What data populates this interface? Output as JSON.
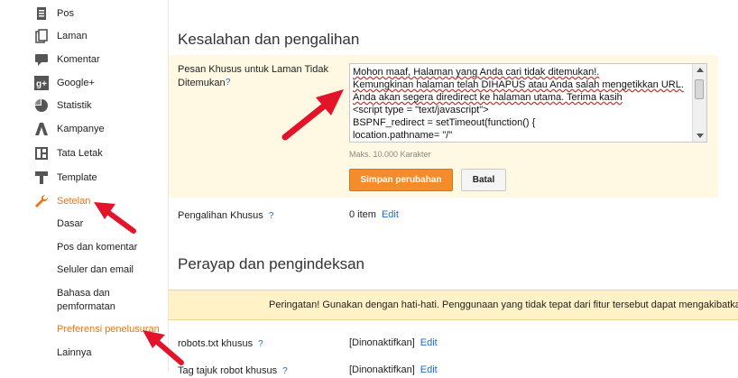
{
  "sidebar": {
    "items": [
      {
        "label": "Pos",
        "icon": "posts-icon"
      },
      {
        "label": "Laman",
        "icon": "pages-icon"
      },
      {
        "label": "Komentar",
        "icon": "comments-icon"
      },
      {
        "label": "Google+",
        "icon": "google-plus-icon"
      },
      {
        "label": "Statistik",
        "icon": "stats-icon"
      },
      {
        "label": "Kampanye",
        "icon": "campaign-icon"
      },
      {
        "label": "Tata Letak",
        "icon": "layout-icon"
      },
      {
        "label": "Template",
        "icon": "template-icon"
      },
      {
        "label": "Setelan",
        "icon": "settings-wrench-icon"
      }
    ],
    "sub_items": [
      "Dasar",
      "Pos dan komentar",
      "Seluler dan email",
      "Bahasa dan\npemformatan",
      "Preferensi penelusuran",
      "Lainnya"
    ]
  },
  "errors_section": {
    "title": "Kesalahan dan pengalihan",
    "custom_404_label": "Pesan Khusus untuk Laman Tidak\nDitemukan",
    "help": "?",
    "message_lines": [
      "Mohon maaf, Halaman yang Anda cari tidak ditemukan!.",
      "Kemungkinan halaman telah DIHAPUS atau Anda salah mengetikkan URL.",
      "Anda akan segera diredirect ke halaman utama. Terima kasih",
      "<script type = \"text/javascript\">",
      "BSPNF_redirect = setTimeout(function() {",
      "location.pathname= \"/\""
    ],
    "max_chars": "Maks. 10.000 Karakter",
    "save_label": "Simpan perubahan",
    "cancel_label": "Batal",
    "redirect_label": "Pengalihan Khusus",
    "redirect_value": "0 item",
    "edit_label": "Edit"
  },
  "crawl_section": {
    "title": "Perayap dan pengindeksan",
    "warning": "Peringatan! Gunakan dengan hati-hati. Penggunaan yang tidak tepat dari fitur tersebut dapat mengakibatkan b",
    "robots_label": "robots.txt khusus",
    "robots_value": "[Dinonaktifkan]",
    "robot_tags_label": "Tag tajuk robot khusus",
    "robot_tags_value": "[Dinonaktifkan]",
    "edit_label": "Edit"
  },
  "colors": {
    "accent": "#e8761c",
    "link": "#1a6ad3",
    "arrow": "#e3132a",
    "panel": "#fff8e3",
    "button": "#f48c2b"
  }
}
